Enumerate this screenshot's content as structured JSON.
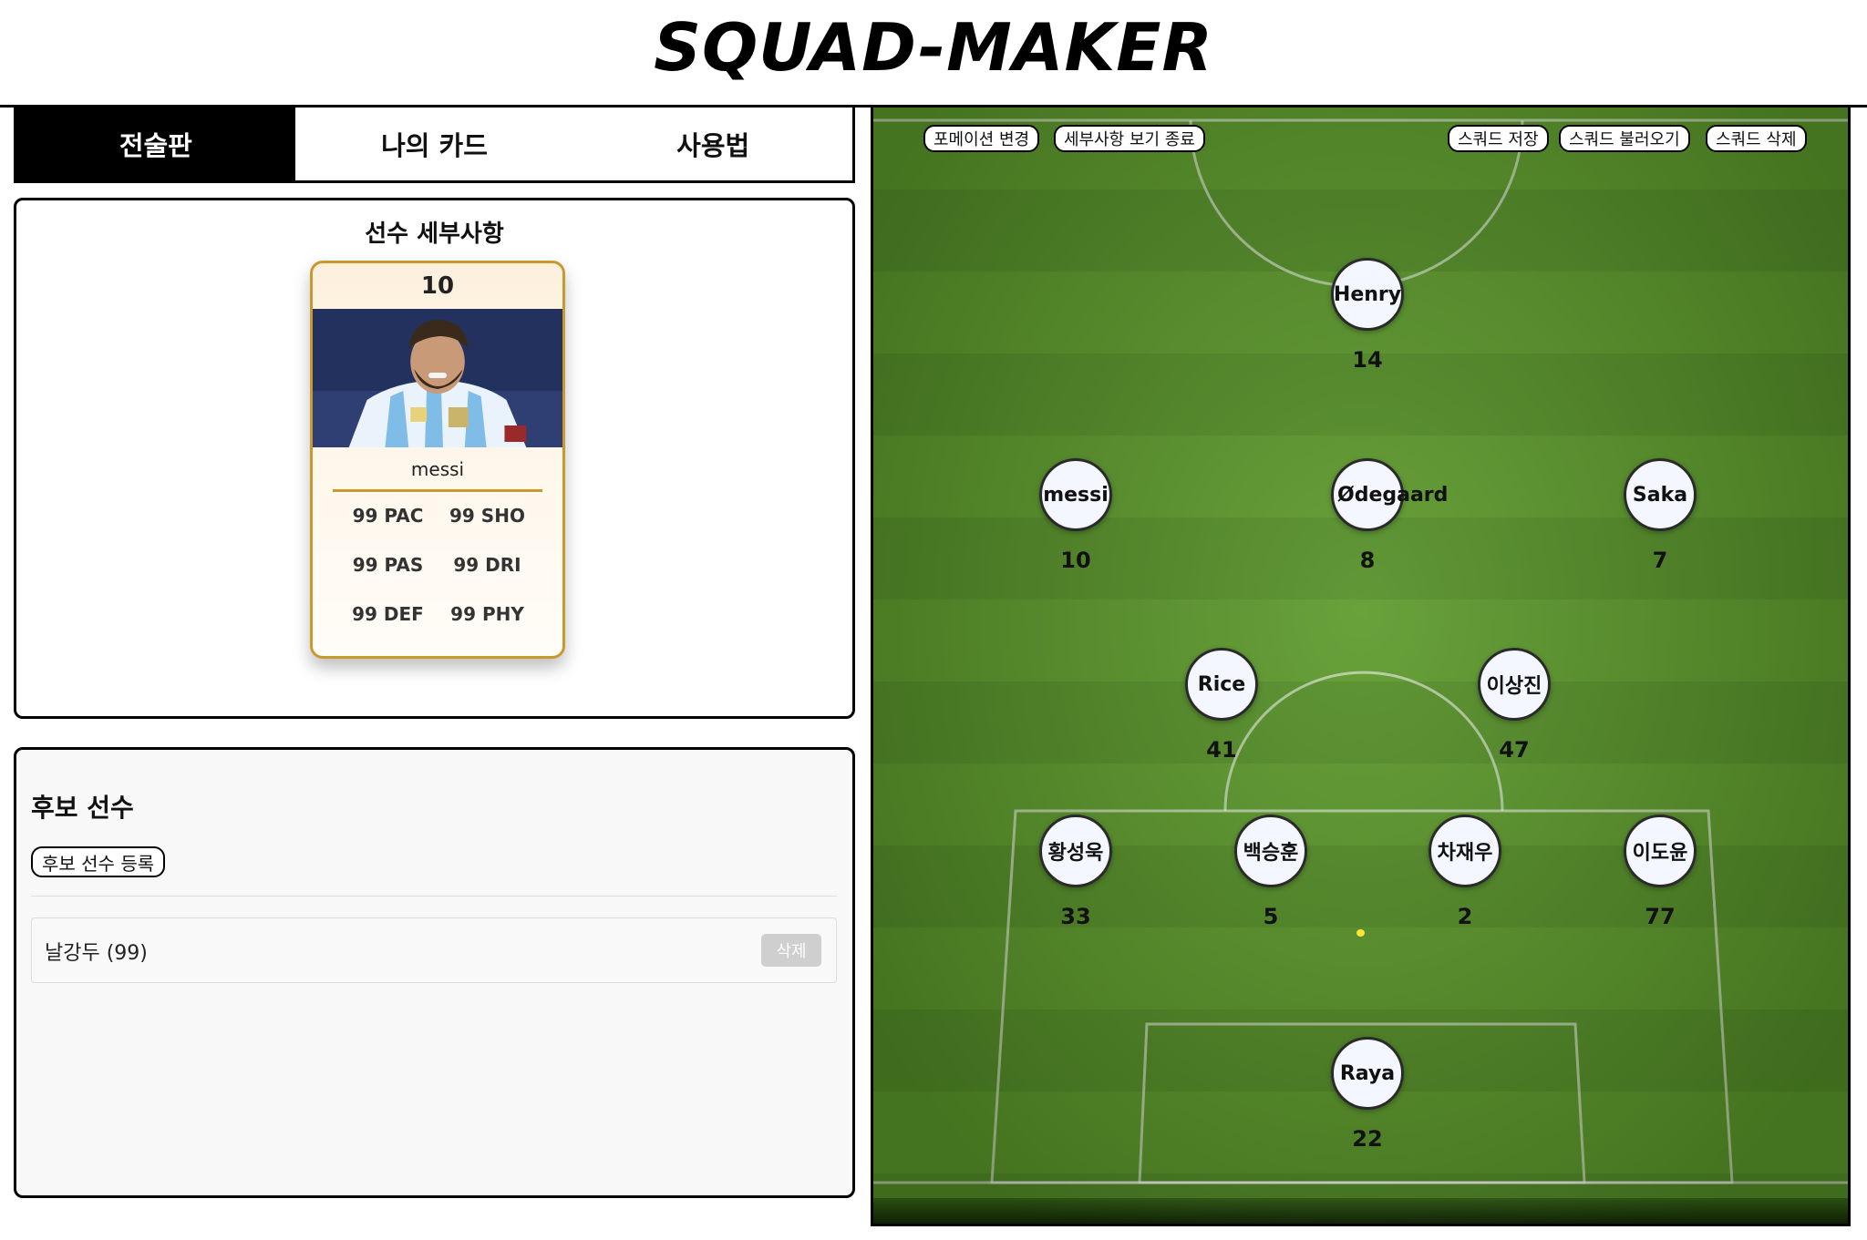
{
  "app": {
    "title": "SQUAD-MAKER"
  },
  "tabs": [
    {
      "label": "전술판",
      "active": true
    },
    {
      "label": "나의 카드",
      "active": false
    },
    {
      "label": "사용법",
      "active": false
    }
  ],
  "details": {
    "heading": "선수 세부사항",
    "card": {
      "number": "10",
      "name": "messi",
      "stats": [
        "99 PAC",
        "99 SHO",
        "99 PAS",
        "99 DRI",
        "99 DEF",
        "99 PHY"
      ]
    }
  },
  "subs": {
    "title": "후보 선수",
    "register_label": "후보 선수 등록",
    "items": [
      {
        "name": "날강두 (99)",
        "delete_label": "삭제"
      }
    ]
  },
  "pitch": {
    "buttons_left": [
      "포메이션 변경",
      "세부사항 보기 종료"
    ],
    "buttons_right": [
      "스쿼드 저장",
      "스쿼드 불러오기",
      "스쿼드 삭제"
    ],
    "players": [
      {
        "name": "Henry",
        "number": "14"
      },
      {
        "name": "messi",
        "number": "10"
      },
      {
        "name": "Ødegaard",
        "number": "8"
      },
      {
        "name": "Saka",
        "number": "7"
      },
      {
        "name": "Rice",
        "number": "41"
      },
      {
        "name": "이상진",
        "number": "47"
      },
      {
        "name": "황성욱",
        "number": "33"
      },
      {
        "name": "백승훈",
        "number": "5"
      },
      {
        "name": "차재우",
        "number": "2"
      },
      {
        "name": "이도윤",
        "number": "77"
      },
      {
        "name": "Raya",
        "number": "22"
      }
    ]
  },
  "colors": {
    "accent": "#000000",
    "card_border": "#c89a2e",
    "pitch_green": "#5c9a2a"
  }
}
